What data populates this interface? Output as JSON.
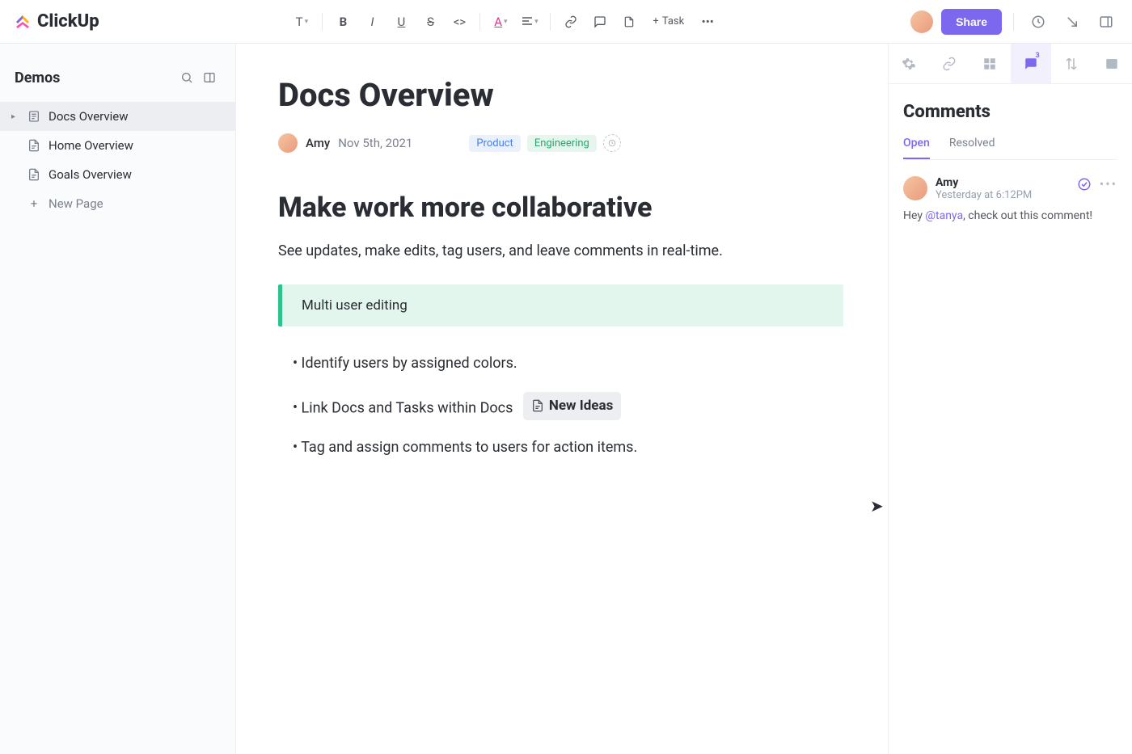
{
  "brand": "ClickUp",
  "topbar": {
    "task_label": "Task",
    "share_label": "Share"
  },
  "sidebar": {
    "title": "Demos",
    "items": [
      {
        "label": "Docs Overview",
        "active": true
      },
      {
        "label": "Home Overview",
        "active": false
      },
      {
        "label": "Goals Overview",
        "active": false
      }
    ],
    "new_page_label": "New Page"
  },
  "doc": {
    "title": "Docs Overview",
    "author": "Amy",
    "date": "Nov 5th, 2021",
    "tags": {
      "product": "Product",
      "engineering": "Engineering"
    },
    "h2": "Make work more collaborative",
    "subtitle": "See updates, make edits, tag users, and leave comments in real-time.",
    "callout": "Multi user editing",
    "bullets": {
      "b1": "Identify users by assigned colors.",
      "b2_pre": "Link Docs and Tasks within Docs",
      "b2_chip": "New Ideas",
      "b3": "Tag and assign comments to users for action items."
    }
  },
  "panel": {
    "title": "Comments",
    "comment_badge": "3",
    "subtabs": {
      "open": "Open",
      "resolved": "Resolved"
    },
    "comment": {
      "author": "Amy",
      "time": "Yesterday at 6:12PM",
      "body_pre": "Hey ",
      "mention": "@tanya",
      "body_post": ", check out this comment!"
    }
  }
}
